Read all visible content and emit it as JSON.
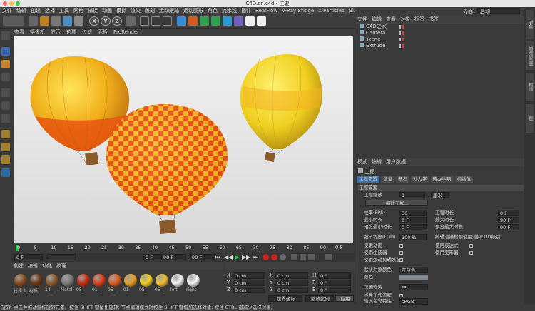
{
  "window": {
    "title": "C4D.cn.c4d - 主要"
  },
  "menu": [
    "文件",
    "编辑",
    "创建",
    "选择",
    "工具",
    "网格",
    "捕捉",
    "动画",
    "模拟",
    "渲染",
    "雕刻",
    "运动跟踪",
    "运动图形",
    "角色",
    "流水线",
    "插件",
    "RealFlow",
    "V-Ray Bridge",
    "X-Particles",
    "脚本",
    "窗口",
    "帮助"
  ],
  "layout": {
    "label": "界面:",
    "value": "启动"
  },
  "toolbar_axes": [
    "X",
    "Y",
    "Z"
  ],
  "viewport_menu": [
    "查看",
    "摄像机",
    "显示",
    "选项",
    "过滤",
    "面板",
    "ProRender"
  ],
  "timeline": {
    "ticks": [
      "0",
      "5",
      "10",
      "15",
      "20",
      "25",
      "30",
      "35",
      "40",
      "45",
      "50",
      "55",
      "60",
      "65",
      "70",
      "75",
      "80",
      "85",
      "90"
    ],
    "current_frame": "0 F",
    "start": "0 F",
    "end": "90 F",
    "end2": "90 F",
    "frame_indicator": "0 F"
  },
  "materials": {
    "menu": [
      "创建",
      "编辑",
      "功能",
      "纹理"
    ],
    "items": [
      {
        "label": "材质.1",
        "color": "#8a4a1e"
      },
      {
        "label": "材质",
        "color": "#6a3a18"
      },
      {
        "label": "14_",
        "color": "#8b5a2b"
      },
      {
        "label": "Metal",
        "color": "#7a7a7a"
      },
      {
        "label": "05_",
        "color": "#c83010"
      },
      {
        "label": "01_",
        "color": "#e04018"
      },
      {
        "label": "05_",
        "color": "#e06020"
      },
      {
        "label": "01_",
        "color": "#e8a020"
      },
      {
        "label": "05_",
        "color": "#f0d020"
      },
      {
        "label": "05_",
        "color": "#f0c030"
      },
      {
        "label": "left",
        "color": "#f4f4f4"
      },
      {
        "label": "right",
        "color": "#f4f4f4"
      }
    ]
  },
  "coords": {
    "rows": [
      {
        "a": "X",
        "av": "0 cm",
        "b": "X",
        "bv": "0 cm",
        "c": "H",
        "cv": "0 °"
      },
      {
        "a": "Y",
        "av": "0 cm",
        "b": "Y",
        "bv": "0 cm",
        "c": "P",
        "cv": "0 °"
      },
      {
        "a": "Z",
        "av": "0 cm",
        "b": "Z",
        "bv": "0 cm",
        "c": "B",
        "cv": "0 °"
      }
    ],
    "mode": "世界坐标",
    "scale": "缩放比例",
    "apply": "应用"
  },
  "status": "旋转: 点击并拖动鼠标旋转元素。按住 SHIFT 键量化旋转; 节点编辑模式时按住 SHIFT 键增加选择对象; 按住 CTRL 键减少选择对象。",
  "objects": {
    "menu": [
      "文件",
      "编辑",
      "查看",
      "对象",
      "标签",
      "书签"
    ],
    "rows": [
      "C4D之家",
      "Camera",
      "scene",
      "Extrude"
    ]
  },
  "side_tabs": [
    "对象",
    "内容浏览器",
    "构造",
    "层"
  ],
  "attributes": {
    "menu": [
      "模式",
      "编辑",
      "用户数据"
    ],
    "title": "工程",
    "tabs": [
      "工程设置",
      "信息",
      "参考",
      "动力学",
      "待办事项",
      "帧插值"
    ],
    "section": "工程设置",
    "scale_label": "工程缩放",
    "scale_value": "1",
    "scale_unit": "厘米",
    "scale_button": "缩放工程...",
    "fps_label": "帧率(FPS)",
    "fps_value": "30",
    "project_time_label": "工程时长",
    "project_time_value": "0 F",
    "min_time_label": "最小时长",
    "min_time_value": "0 F",
    "max_time_label": "最大时长",
    "max_time_value": "90 F",
    "preview_min_label": "预览最小时长",
    "preview_min_value": "0 F",
    "preview_max_label": "预览最大时长",
    "preview_max_value": "90 F",
    "lod_label": "细节程度(LOD)",
    "lod_value": "100 %",
    "render_lod_label": "编辑渲染检视使用渲染LOD级别",
    "use_anim": "使用动画",
    "use_expr": "使用表达式",
    "use_gen": "使用生成器",
    "use_deform": "使用变形器",
    "use_motion": "使用运动剪辑系统",
    "default_color_label": "默认对象颜色",
    "default_color_value": "灰蓝色",
    "color_label": "颜色",
    "view_clip_label": "视图修剪",
    "view_clip_value": "中",
    "linear_label": "线性工作流程",
    "input_color_label": "输入色彩特性",
    "input_color_value": "sRGB"
  }
}
